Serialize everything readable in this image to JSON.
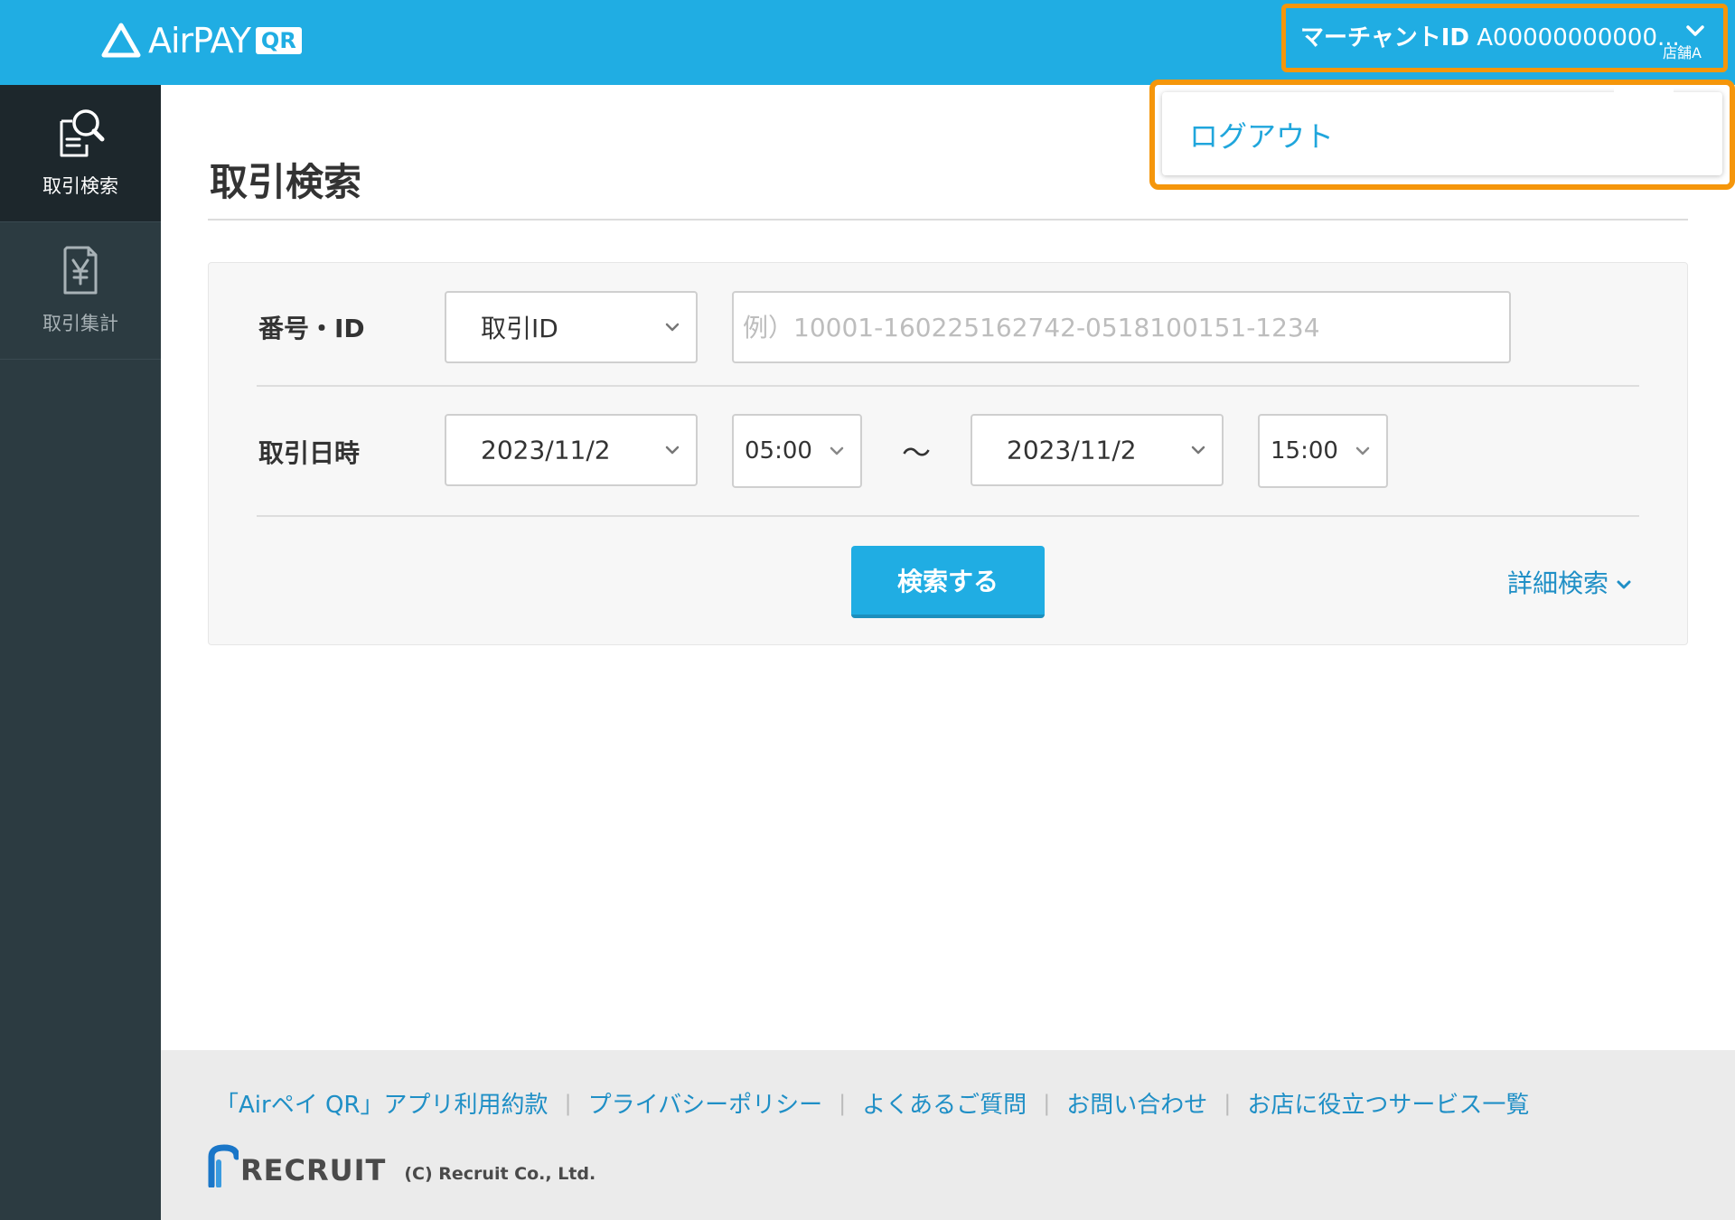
{
  "header": {
    "logo_text": "AirPAY",
    "logo_badge": "QR",
    "merchant_label": "マーチャントID",
    "merchant_value": "A00000000000...",
    "store_name": "店舗A"
  },
  "dropdown": {
    "logout_label": "ログアウト"
  },
  "sidebar": {
    "items": [
      {
        "label": "取引検索",
        "icon": "search-document-icon",
        "active": true
      },
      {
        "label": "取引集計",
        "icon": "yen-document-icon",
        "active": false
      }
    ]
  },
  "main": {
    "title": "取引検索",
    "form": {
      "number_row_label": "番号・ID",
      "id_type_selected": "取引ID",
      "id_placeholder": "例）10001-160225162742-0518100151-1234",
      "datetime_row_label": "取引日時",
      "start_date": "2023/11/2",
      "start_time": "05:00",
      "range_separator": "〜",
      "end_date": "2023/11/2",
      "end_time": "15:00",
      "search_button": "検索する",
      "detail_search_link": "詳細検索"
    }
  },
  "footer": {
    "links": [
      "「Airペイ QR」アプリ利用約款",
      "プライバシーポリシー",
      "よくあるご質問",
      "お問い合わせ",
      "お店に役立つサービス一覧"
    ],
    "separator": "|",
    "company_logo": "RECRUIT",
    "copyright": "(C) Recruit Co., Ltd."
  },
  "colors": {
    "brand_blue": "#20ade3",
    "highlight_orange": "#f5960b",
    "sidebar_bg": "#2c3b41",
    "link_blue": "#1f8fc6"
  }
}
